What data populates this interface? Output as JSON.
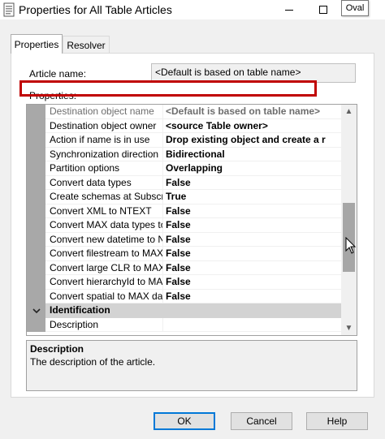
{
  "window": {
    "title": "Properties for All Table Articles",
    "tooltip": "Oval"
  },
  "tabs": [
    {
      "label": "Properties",
      "selected": true
    },
    {
      "label": "Resolver",
      "selected": false
    }
  ],
  "article": {
    "label": "Article name:",
    "value": "<Default is based on table name>"
  },
  "properties_label": "Properties:",
  "grid": {
    "rows": [
      {
        "name": "Destination object name",
        "value": "<Default is based on table name>",
        "disabled": true
      },
      {
        "name": "Destination object owner",
        "value": "<source Table owner>"
      },
      {
        "name": "Action if name is in use",
        "value": "Drop existing object and create a r",
        "highlighted": true
      },
      {
        "name": "Synchronization direction",
        "value": "Bidirectional"
      },
      {
        "name": "Partition options",
        "value": "Overlapping"
      },
      {
        "name": "Convert data types",
        "value": "False"
      },
      {
        "name": "Create schemas at Subscr",
        "value": "True"
      },
      {
        "name": "Convert XML to NTEXT",
        "value": "False"
      },
      {
        "name": "Convert MAX data types to",
        "value": "False"
      },
      {
        "name": "Convert new datetime to N",
        "value": "False"
      },
      {
        "name": "Convert filestream to MAX",
        "value": "False"
      },
      {
        "name": "Convert large CLR to MAX",
        "value": "False"
      },
      {
        "name": "Convert hierarchyId to MA",
        "value": "False"
      },
      {
        "name": "Convert spatial to MAX dat",
        "value": "False"
      }
    ],
    "category": "Identification",
    "category_rows": [
      {
        "name": "Description",
        "value": ""
      }
    ],
    "scroll_position": 0.62
  },
  "description_panel": {
    "title": "Description",
    "text": "The description of the article."
  },
  "buttons": {
    "ok": "OK",
    "cancel": "Cancel",
    "help": "Help"
  },
  "colors": {
    "highlight_border": "#c00000",
    "focus_border": "#0078d7"
  }
}
